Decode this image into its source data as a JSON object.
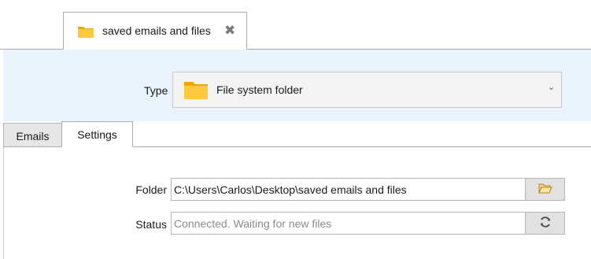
{
  "document_tab": {
    "title": "saved emails and files",
    "icon": "folder-icon",
    "close_icon": "close-icon"
  },
  "type_selector": {
    "label": "Type",
    "value": "File system folder",
    "icon": "folder-icon"
  },
  "tabs": [
    {
      "label": "Emails",
      "active": false
    },
    {
      "label": "Settings",
      "active": true
    }
  ],
  "settings": {
    "folder_label": "Folder",
    "folder_value": "C:\\Users\\Carlos\\Desktop\\saved emails and files",
    "status_label": "Status",
    "status_value": "Connected. Waiting for new files"
  },
  "colors": {
    "accent_band": "#eaf2fb",
    "folder_yellow": "#ffc83d",
    "folder_dark": "#e8a800"
  }
}
